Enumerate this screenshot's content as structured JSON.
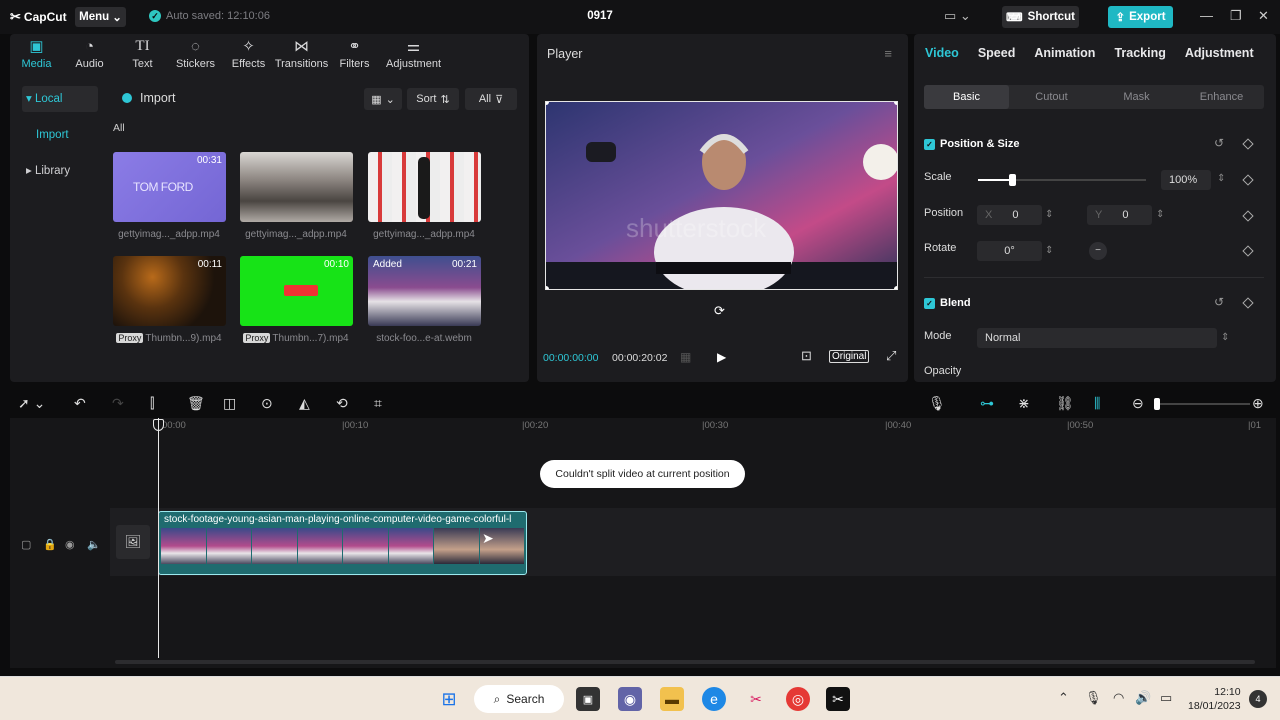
{
  "app": {
    "logo": "CapCut",
    "menu_label": "Menu",
    "autosave": "Auto saved: 12:10:06",
    "project_title": "0917",
    "shortcut_label": "Shortcut",
    "export_label": "Export"
  },
  "toolbar": [
    "Media",
    "Audio",
    "Text",
    "Stickers",
    "Effects",
    "Transitions",
    "Filters",
    "Adjustment"
  ],
  "sidebar": {
    "local": "Local",
    "import": "Import",
    "library": "Library"
  },
  "media": {
    "import_label": "Import",
    "sort_label": "Sort",
    "filter_label": "All",
    "all_label": "All",
    "items": [
      {
        "name": "gettyimag..._adpp.mp4",
        "duration": "00:31",
        "thumb_text": "TOM FORD",
        "proxy": ""
      },
      {
        "name": "gettyimag..._adpp.mp4",
        "duration": "",
        "thumb_text": "",
        "proxy": ""
      },
      {
        "name": "gettyimag..._adpp.mp4",
        "duration": "",
        "thumb_text": "",
        "proxy": ""
      },
      {
        "name": "Thumbn...9).mp4",
        "duration": "00:11",
        "thumb_text": "",
        "proxy": "Proxy"
      },
      {
        "name": "Thumbn...7).mp4",
        "duration": "00:10",
        "thumb_text": "",
        "proxy": "Proxy"
      },
      {
        "name": "stock-foo...e-at.webm",
        "duration": "00:21",
        "thumb_text": "",
        "proxy": "",
        "added": "Added"
      }
    ]
  },
  "player": {
    "title": "Player",
    "current_time": "00:00:00:00",
    "total_time": "00:00:20:02",
    "original_label": "Original",
    "watermark": "shutterstock"
  },
  "properties": {
    "tabs": [
      "Video",
      "Speed",
      "Animation",
      "Tracking",
      "Adjustment"
    ],
    "subtabs": [
      "Basic",
      "Cutout",
      "Mask",
      "Enhance"
    ],
    "position_size": "Position & Size",
    "scale_label": "Scale",
    "scale_value": "100%",
    "scale_fraction": 0.2,
    "position_label": "Position",
    "pos_x_axis": "X",
    "pos_x": "0",
    "pos_y_axis": "Y",
    "pos_y": "0",
    "rotate_label": "Rotate",
    "rotate_value": "0°",
    "blend": "Blend",
    "mode_label": "Mode",
    "mode_value": "Normal",
    "opacity_label": "Opacity"
  },
  "timeline": {
    "ticks": [
      "00:00",
      "00:10",
      "00:20",
      "00:30",
      "00:40",
      "00:50",
      "01"
    ],
    "toast": "Couldn't split video at current position",
    "clip_name": "stock-footage-young-asian-man-playing-online-computer-video-game-colorful-l"
  },
  "taskbar": {
    "search": "Search",
    "time": "12:10",
    "date": "18/01/2023",
    "notifications": "4"
  }
}
